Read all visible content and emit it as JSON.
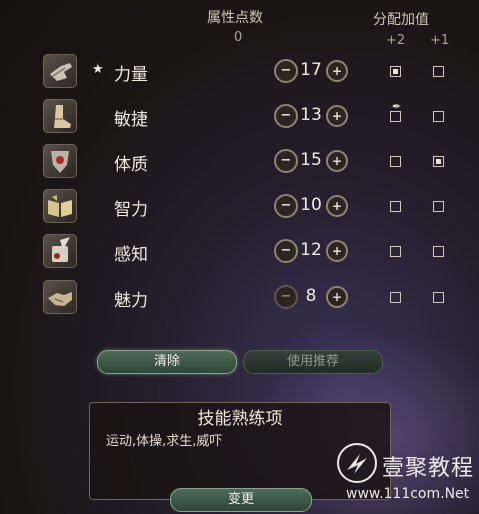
{
  "header": {
    "attribute_points_label": "属性点数",
    "attribute_points_value": "0",
    "allocate_label": "分配加值",
    "plus_two_label": "+2",
    "plus_one_label": "+1"
  },
  "controls": {
    "minus_symbol": "−",
    "plus_symbol": "+"
  },
  "attributes": [
    {
      "name": "力量",
      "value": "17",
      "starred": true,
      "icon": "gauntlet-icon",
      "bonus_plus_two": true,
      "bonus_plus_one": false,
      "minus_enabled": true
    },
    {
      "name": "敏捷",
      "value": "13",
      "starred": false,
      "icon": "boot-icon",
      "bonus_plus_two": false,
      "bonus_plus_one": false,
      "minus_enabled": true,
      "plus_two_feather": true
    },
    {
      "name": "体质",
      "value": "15",
      "starred": false,
      "icon": "shield-heart-icon",
      "bonus_plus_two": false,
      "bonus_plus_one": true,
      "minus_enabled": true
    },
    {
      "name": "智力",
      "value": "10",
      "starred": false,
      "icon": "open-book-icon",
      "bonus_plus_two": false,
      "bonus_plus_one": false,
      "minus_enabled": true
    },
    {
      "name": "感知",
      "value": "12",
      "starred": false,
      "icon": "scroll-quill-icon",
      "bonus_plus_two": false,
      "bonus_plus_one": false,
      "minus_enabled": true
    },
    {
      "name": "魅力",
      "value": "8",
      "starred": false,
      "icon": "handshake-icon",
      "bonus_plus_two": false,
      "bonus_plus_one": false,
      "minus_enabled": false
    }
  ],
  "buttons": {
    "clear": "清除",
    "recommend": "使用推荐",
    "change": "变更"
  },
  "skills": {
    "title": "技能熟练项",
    "list": "运动,体操,求生,威吓"
  },
  "watermark": {
    "brand": "壹聚教程",
    "url": "www.111com.Net"
  }
}
